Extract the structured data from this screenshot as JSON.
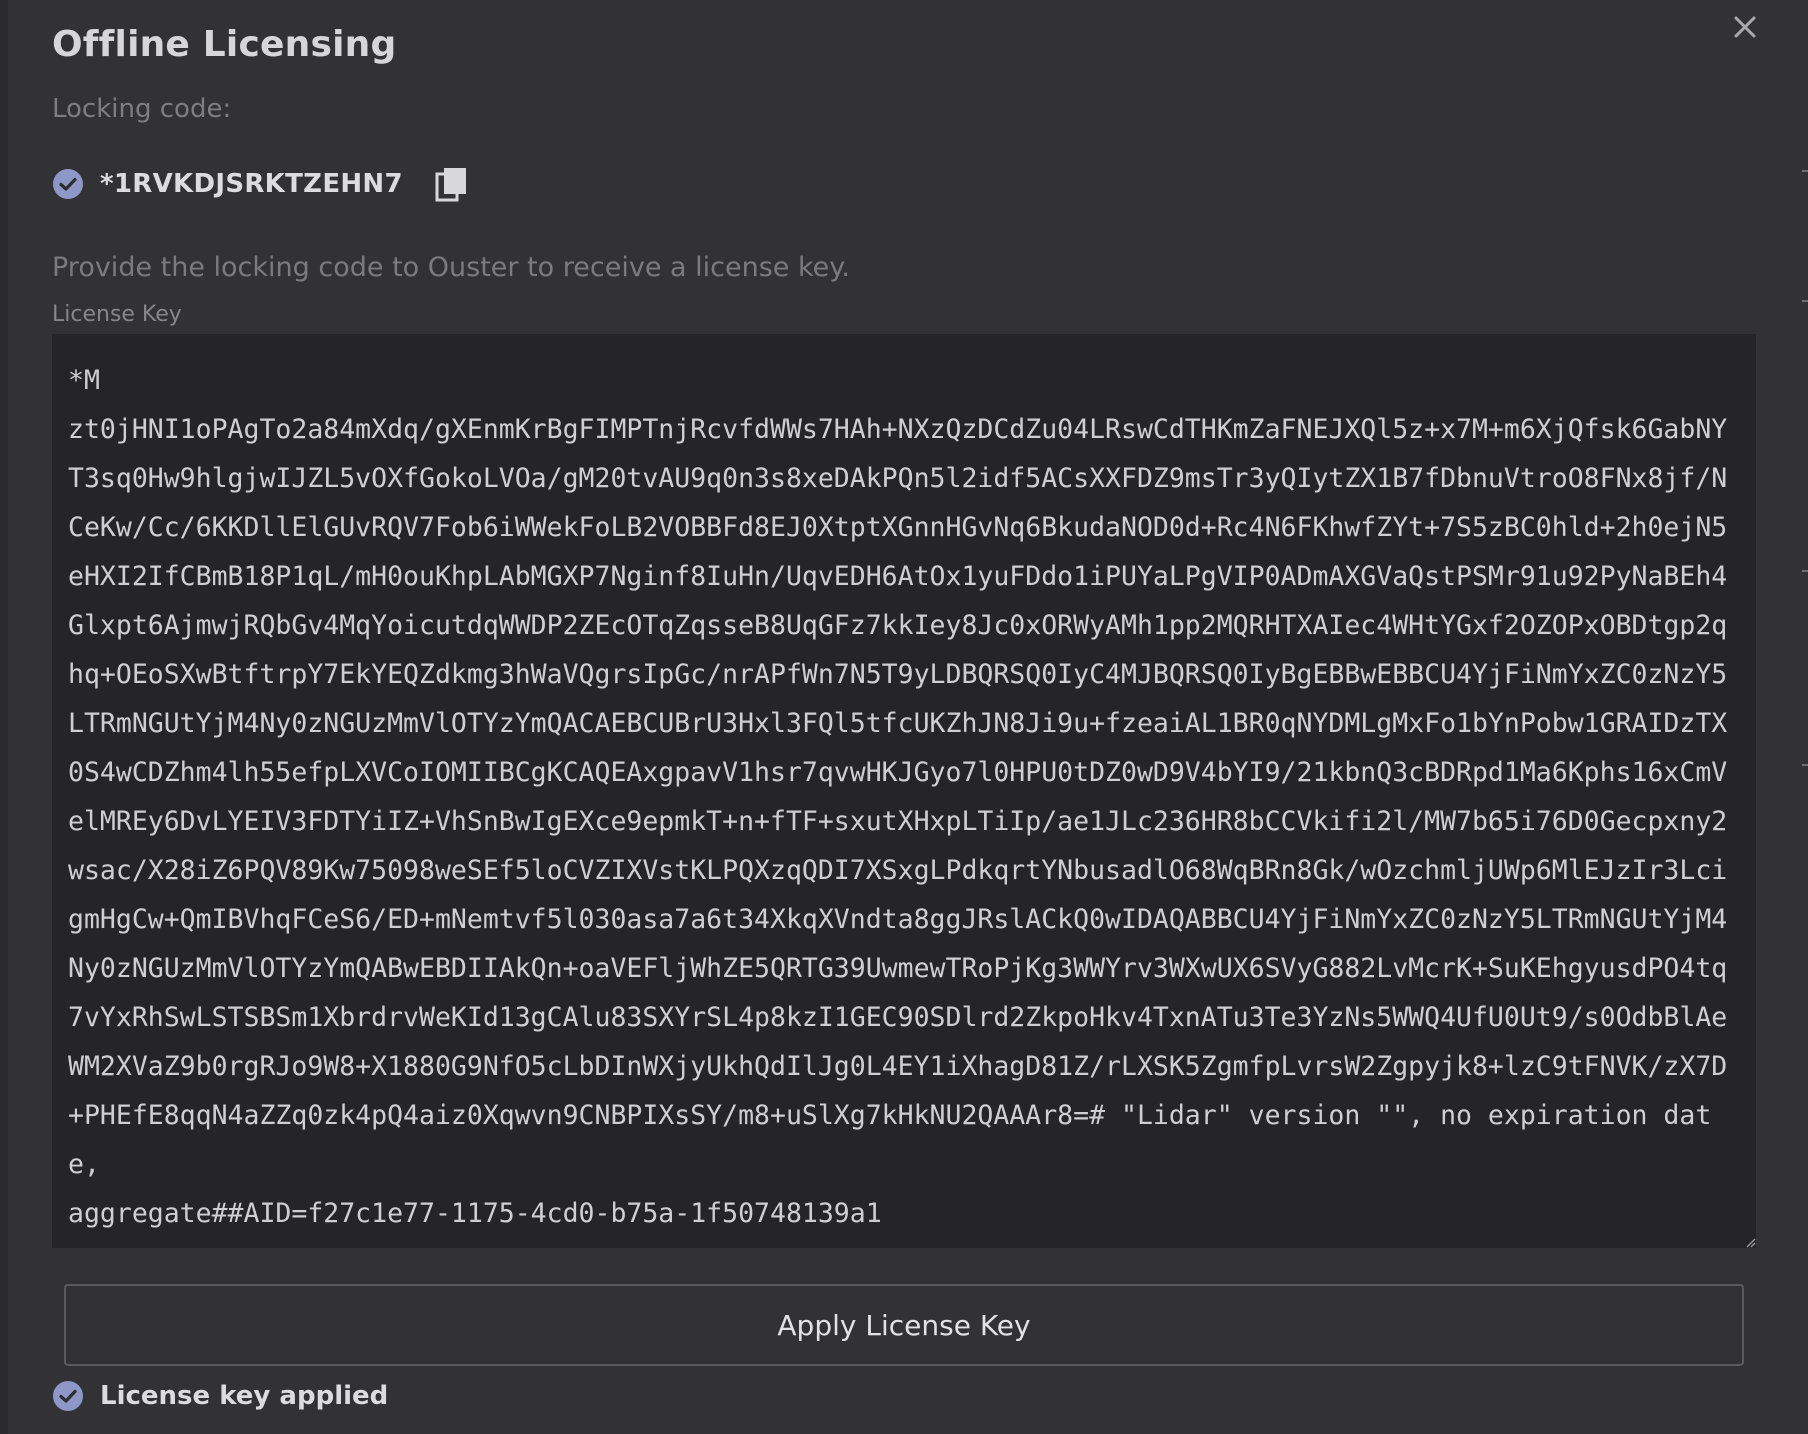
{
  "dialog": {
    "title": "Offline Licensing",
    "close_icon": "close-icon"
  },
  "locking": {
    "label": "Locking code:",
    "code": "*1RVKDJSRKTZEHN7",
    "status_icon": "check-circle-icon",
    "copy_icon": "copy-icon"
  },
  "info_text": "Provide the locking code to Ouster to receive a license key.",
  "license_key": {
    "label": "License Key",
    "value": "*M\nzt0jHNI1oPAgTo2a84mXdq/gXEnmKrBgFIMPTnjRcvfdWWs7HAh+NXzQzDCdZu04LRswCdTHKmZaFNEJXQl5z+x7M+m6XjQfsk6GabNYT3sq0Hw9hlgjwIJZL5vOXfGokoLVOa/gM20tvAU9q0n3s8xeDAkPQn5l2idf5ACsXXFDZ9msTr3yQIytZX1B7fDbnuVtroO8FNx8jf/NCeKw/Cc/6KKDllElGUvRQV7Fob6iWWekFoLB2VOBBFd8EJ0XtptXGnnHGvNq6BkudaNOD0d+Rc4N6FKhwfZYt+7S5zBC0hld+2h0ejN5eHXI2IfCBmB18P1qL/mH0ouKhpLAbMGXP7Nginf8IuHn/UqvEDH6AtOx1yuFDdo1iPUYaLPgVIP0ADmAXGVaQstPSMr91u92PyNaBEh4Glxpt6AjmwjRQbGv4MqYoicutdqWWDP2ZEcOTqZqsseB8UqGFz7kkIey8Jc0xORWyAMh1pp2MQRHTXAIec4WHtYGxf2OZOPxOBDtgp2qhq+OEoSXwBtftrpY7EkYEQZdkmg3hWaVQgrsIpGc/nrAPfWn7N5T9yLDBQRSQ0IyC4MJBQRSQ0IyBgEBBwEBBCU4YjFiNmYxZC0zNzY5LTRmNGUtYjM4Ny0zNGUzMmVlOTYzYmQACAEBCUBrU3Hxl3FQl5tfcUKZhJN8Ji9u+fzeaiAL1BR0qNYDMLgMxFo1bYnPobw1GRAIDzTX0S4wCDZhm4lh55efpLXVCoIOMIIBCgKCAQEAxgpavV1hsr7qvwHKJGyo7l0HPU0tDZ0wD9V4bYI9/21kbnQ3cBDRpd1Ma6Kphs16xCmVelMREy6DvLYEIV3FDTYiIZ+VhSnBwIgEXce9epmkT+n+fTF+sxutXHxpLTiIp/ae1JLc236HR8bCCVkifi2l/MW7b65i76D0Gecpxny2wsac/X28iZ6PQV89Kw75098weSEf5loCVZIXVstKLPQXzqQDI7XSxgLPdkqrtYNbusadlO68WqBRn8Gk/wOzchmljUWp6MlEJzIr3LcigmHgCw+QmIBVhqFCeS6/ED+mNemtvf5l030asa7a6t34XkqXVndta8ggJRslACkQ0wIDAQABBCU4YjFiNmYxZC0zNzY5LTRmNGUtYjM4Ny0zNGUzMmVlOTYzYmQABwEBDIIAkQn+oaVEFljWhZE5QRTG39UwmewTRoPjKg3WWYrv3WXwUX6SVyG882LvMcrK+SuKEhgyusdPO4tq7vYxRhSwLSTSBSm1XbrdrvWeKId13gCAlu83SXYrSL4p8kzI1GEC90SDlrd2ZkpoHkv4TxnATu3Te3YzNs5WWQ4UfU0Ut9/s0OdbBlAeWM2XVaZ9b0rgRJo9W8+X1880G9NfO5cLbDInWXjyUkhQdIlJg0L4EY1iXhagD81Z/rLXSK5ZgmfpLvrsW2Zgpyjk8+lzC9tFNVK/zX7D+PHEfE8qqN4aZZq0zk4pQ4aiz0Xqwvn9CNBPIXsSY/m8+uSlXg7kHkNU2QAAAr8=# \"Lidar\" version \"\", no expiration date,\naggregate##AID=f27c1e77-1175-4cd0-b75a-1f50748139a1"
  },
  "apply_button": {
    "label": "Apply License Key"
  },
  "status": {
    "text": "License key applied",
    "icon": "check-circle-icon"
  },
  "colors": {
    "background": "#323235",
    "textarea_bg": "#252527",
    "accent_check": "#8d98c8",
    "title_text": "#d6d6d8",
    "muted_text": "#7d7d82"
  }
}
